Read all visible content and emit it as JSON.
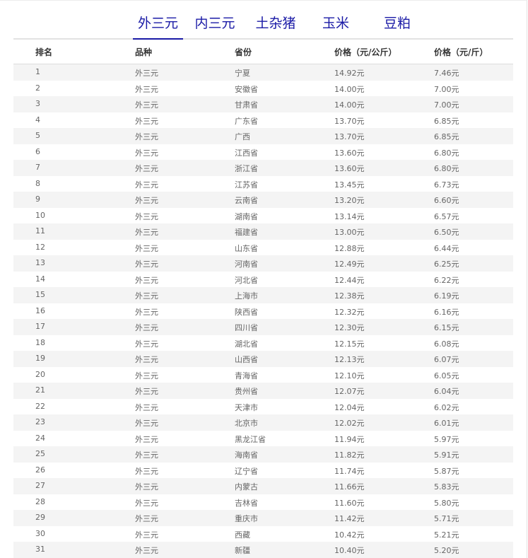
{
  "tabs": [
    "外三元",
    "内三元",
    "土杂猪",
    "玉米",
    "豆粕"
  ],
  "headers": [
    "排名",
    "品种",
    "省份",
    "价格（元/公斤）",
    "价格（元/斤）"
  ],
  "rows": [
    [
      "1",
      "外三元",
      "宁夏",
      "14.92元",
      "7.46元"
    ],
    [
      "2",
      "外三元",
      "安徽省",
      "14.00元",
      "7.00元"
    ],
    [
      "3",
      "外三元",
      "甘肃省",
      "14.00元",
      "7.00元"
    ],
    [
      "4",
      "外三元",
      "广东省",
      "13.70元",
      "6.85元"
    ],
    [
      "5",
      "外三元",
      "广西",
      "13.70元",
      "6.85元"
    ],
    [
      "6",
      "外三元",
      "江西省",
      "13.60元",
      "6.80元"
    ],
    [
      "7",
      "外三元",
      "浙江省",
      "13.60元",
      "6.80元"
    ],
    [
      "8",
      "外三元",
      "江苏省",
      "13.45元",
      "6.73元"
    ],
    [
      "9",
      "外三元",
      "云南省",
      "13.20元",
      "6.60元"
    ],
    [
      "10",
      "外三元",
      "湖南省",
      "13.14元",
      "6.57元"
    ],
    [
      "11",
      "外三元",
      "福建省",
      "13.00元",
      "6.50元"
    ],
    [
      "12",
      "外三元",
      "山东省",
      "12.88元",
      "6.44元"
    ],
    [
      "13",
      "外三元",
      "河南省",
      "12.49元",
      "6.25元"
    ],
    [
      "14",
      "外三元",
      "河北省",
      "12.44元",
      "6.22元"
    ],
    [
      "15",
      "外三元",
      "上海市",
      "12.38元",
      "6.19元"
    ],
    [
      "16",
      "外三元",
      "陕西省",
      "12.32元",
      "6.16元"
    ],
    [
      "17",
      "外三元",
      "四川省",
      "12.30元",
      "6.15元"
    ],
    [
      "18",
      "外三元",
      "湖北省",
      "12.15元",
      "6.08元"
    ],
    [
      "19",
      "外三元",
      "山西省",
      "12.13元",
      "6.07元"
    ],
    [
      "20",
      "外三元",
      "青海省",
      "12.10元",
      "6.05元"
    ],
    [
      "21",
      "外三元",
      "贵州省",
      "12.07元",
      "6.04元"
    ],
    [
      "22",
      "外三元",
      "天津市",
      "12.04元",
      "6.02元"
    ],
    [
      "23",
      "外三元",
      "北京市",
      "12.02元",
      "6.01元"
    ],
    [
      "24",
      "外三元",
      "黑龙江省",
      "11.94元",
      "5.97元"
    ],
    [
      "25",
      "外三元",
      "海南省",
      "11.82元",
      "5.91元"
    ],
    [
      "26",
      "外三元",
      "辽宁省",
      "11.74元",
      "5.87元"
    ],
    [
      "27",
      "外三元",
      "内蒙古",
      "11.66元",
      "5.83元"
    ],
    [
      "28",
      "外三元",
      "吉林省",
      "11.60元",
      "5.80元"
    ],
    [
      "29",
      "外三元",
      "重庆市",
      "11.42元",
      "5.71元"
    ],
    [
      "30",
      "外三元",
      "西藏",
      "10.42元",
      "5.21元"
    ],
    [
      "31",
      "外三元",
      "新疆",
      "10.40元",
      "5.20元"
    ]
  ],
  "colors": {
    "tab_text": "#1a1aa6",
    "stripe": "#f4f4f4"
  }
}
